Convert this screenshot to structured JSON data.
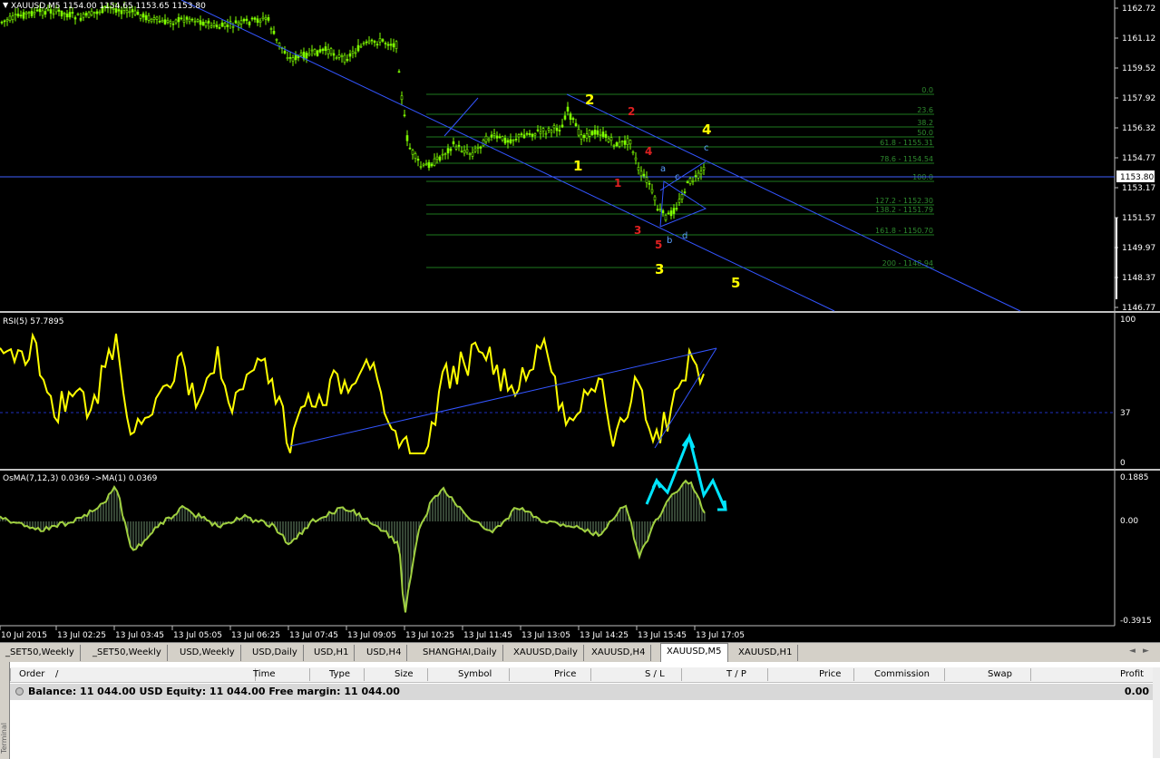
{
  "window": {
    "symbol_header": "XAUUSD,M5  1154.00  1154.65  1153.65  1153.80"
  },
  "colors": {
    "background": "#000000",
    "candles": "#7fff00",
    "channel": "#3355ff",
    "fib": "#1e7a1e",
    "rsi": "#ffff00",
    "osma": "#a0d040",
    "arrows": "#00e5ff",
    "wave_yellow": "#ffff00",
    "wave_red": "#dd2020",
    "wave_blue": "#5aa0ff"
  },
  "main_chart": {
    "price_axis": [
      "1162.72",
      "1161.12",
      "1159.52",
      "1157.92",
      "1156.32",
      "1154.77",
      "1153.17",
      "1151.57",
      "1149.97",
      "1148.37",
      "1146.77"
    ],
    "current_price": "1153.80",
    "fib_levels": [
      "0.0",
      "23.6",
      "38.2",
      "50.0",
      "61.8 - 1155.31",
      "78.6 - 1154.54",
      "100.0",
      "127.2 - 1152.30",
      "138.2 - 1151.79",
      "161.8 - 1150.70",
      "200 - 1148.94"
    ],
    "wave_labels": {
      "yellow": [
        "1",
        "2",
        "3",
        "4",
        "5"
      ],
      "red": [
        "1",
        "2",
        "3",
        "4",
        "5"
      ],
      "blue": [
        "a",
        "b",
        "c",
        "d",
        "c"
      ]
    }
  },
  "rsi_panel": {
    "label": "RSI(5) 57.7895",
    "axis": [
      "100",
      "37",
      "0"
    ]
  },
  "osma_panel": {
    "label": "OsMA(7,12,3) 0.0369  ->MA(1) 0.0369",
    "axis": [
      "0.1885",
      "0.00",
      "-0.3915"
    ]
  },
  "time_axis": [
    "10 Jul 2015",
    "13 Jul 02:25",
    "13 Jul 03:45",
    "13 Jul 05:05",
    "13 Jul 06:25",
    "13 Jul 07:45",
    "13 Jul 09:05",
    "13 Jul 10:25",
    "13 Jul 11:45",
    "13 Jul 13:05",
    "13 Jul 14:25",
    "13 Jul 15:45",
    "13 Jul 17:05"
  ],
  "tabs": [
    "_SET50,Weekly",
    "_SET50,Weekly",
    "USD,Weekly",
    "USD,Daily",
    "USD,H1",
    "USD,H4",
    "SHANGHAI,Daily",
    "XAUUSD,Daily",
    "XAUUSD,H4",
    "XAUUSD,M5",
    "XAUUSD,H1"
  ],
  "active_tab": "XAUUSD,M5",
  "terminal": {
    "columns": [
      "Order",
      "/",
      "Time",
      "Type",
      "Size",
      "Symbol",
      "Price",
      "S / L",
      "T / P",
      "Price",
      "Commission",
      "Swap",
      "Profit"
    ],
    "balance_text": "Balance: 11 044.00 USD  Equity: 11 044.00  Free margin: 11 044.00",
    "profit": "0.00",
    "side_label": "Terminal"
  }
}
